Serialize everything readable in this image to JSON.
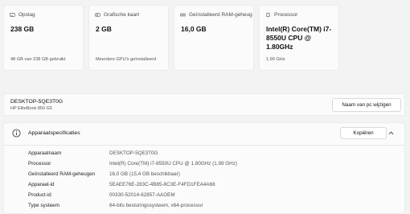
{
  "cards": [
    {
      "label": "Opslag",
      "icon": "storage-icon",
      "value": "238 GB",
      "sub": "48 GB van 238 GB gebruikt"
    },
    {
      "label": "Grafische kaart",
      "icon": "graphics-card-icon",
      "value": "2 GB",
      "sub": "Meerdere GPU's geïnstalleerd"
    },
    {
      "label": "Geïnstalleerd RAM-geheug",
      "icon": "ram-icon",
      "value": "16,0 GB",
      "sub": ""
    },
    {
      "label": "Processor",
      "icon": "processor-icon",
      "value": "Intel(R) Core(TM) i7-8550U CPU @ 1.80GHz",
      "sub": "1,99 GHz"
    }
  ],
  "device": {
    "name": "DESKTOP-5QE3T0G",
    "model": "HP EliteBook 850 G5",
    "rename_label": "Naam van pc wijzigen"
  },
  "specs": {
    "title": "Apparaatspecificaties",
    "copy_label": "Kopiëren",
    "rows": [
      {
        "key": "Apparaatnaam",
        "value": "DESKTOP-5QE3T0G"
      },
      {
        "key": "Processor",
        "value": "Intel(R) Core(TM) i7-8550U CPU @ 1.80GHz (1.99 GHz)"
      },
      {
        "key": "Geïnstalleerd RAM-geheugen",
        "value": "16,0 GB (15,4 GB beschikbaar)"
      },
      {
        "key": "Apparaat-id",
        "value": "5EAEE76E-283C-4B85-8C3E-F4FD1FEA4A68"
      },
      {
        "key": "Product-id",
        "value": "00330-52014-62857-AAOEM"
      },
      {
        "key": "Type systeem",
        "value": "64-bits besturingssysteem, x64-processor"
      }
    ]
  }
}
